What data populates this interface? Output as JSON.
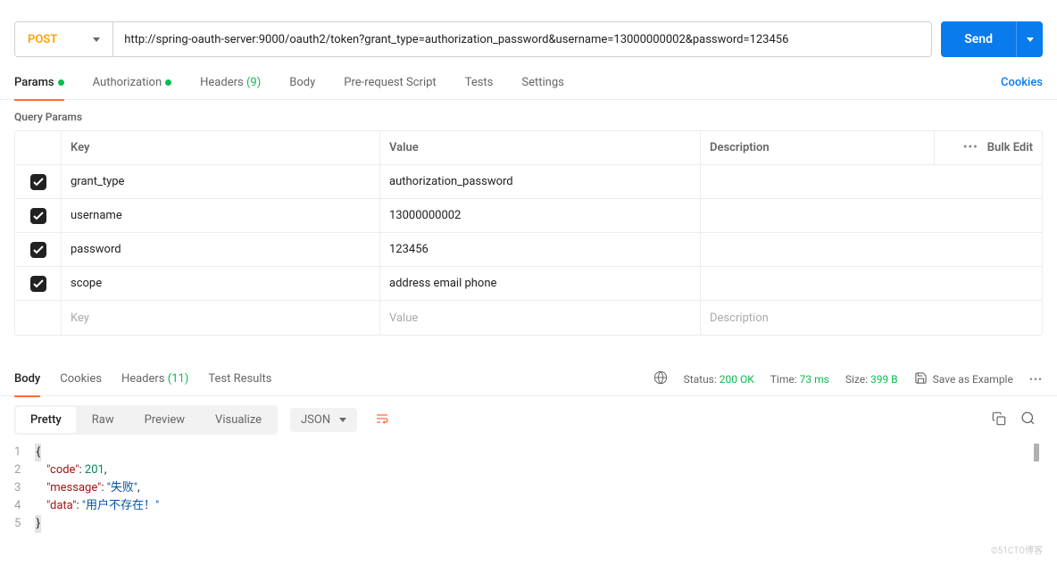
{
  "request": {
    "method": "POST",
    "url": "http://spring-oauth-server:9000/oauth2/token?grant_type=authorization_password&username=13000000002&password=123456",
    "send_label": "Send"
  },
  "tabs": {
    "params": "Params",
    "authorization": "Authorization",
    "headers": "Headers",
    "headers_count": "(9)",
    "body": "Body",
    "pre_request": "Pre-request Script",
    "tests": "Tests",
    "settings": "Settings",
    "cookies": "Cookies"
  },
  "query_params": {
    "title": "Query Params",
    "headers": {
      "key": "Key",
      "value": "Value",
      "description": "Description"
    },
    "bulk_edit": "Bulk Edit",
    "more": "•••",
    "rows": [
      {
        "key": "grant_type",
        "value": "authorization_password"
      },
      {
        "key": "username",
        "value": "13000000002"
      },
      {
        "key": "password",
        "value": "123456"
      },
      {
        "key": "scope",
        "value": "address email phone"
      }
    ],
    "placeholder": {
      "key": "Key",
      "value": "Value",
      "description": "Description"
    }
  },
  "response": {
    "tabs": {
      "body": "Body",
      "cookies": "Cookies",
      "headers": "Headers",
      "headers_count": "(11)",
      "test_results": "Test Results"
    },
    "status_label": "Status:",
    "status_value": "200 OK",
    "time_label": "Time:",
    "time_value": "73 ms",
    "size_label": "Size:",
    "size_value": "399 B",
    "save_example": "Save as Example",
    "more": "•••"
  },
  "body_toolbar": {
    "pretty": "Pretty",
    "raw": "Raw",
    "preview": "Preview",
    "visualize": "Visualize",
    "format": "JSON"
  },
  "response_body": {
    "code": 201,
    "message": "失败",
    "data": "用户不存在！"
  },
  "code_labels": {
    "code": "\"code\"",
    "message": "\"message\"",
    "data": "\"data\""
  },
  "code_values": {
    "code": "201",
    "message": "\"失败\"",
    "data": "\"用户不存在！\""
  },
  "watermark": "©51CTO博客"
}
